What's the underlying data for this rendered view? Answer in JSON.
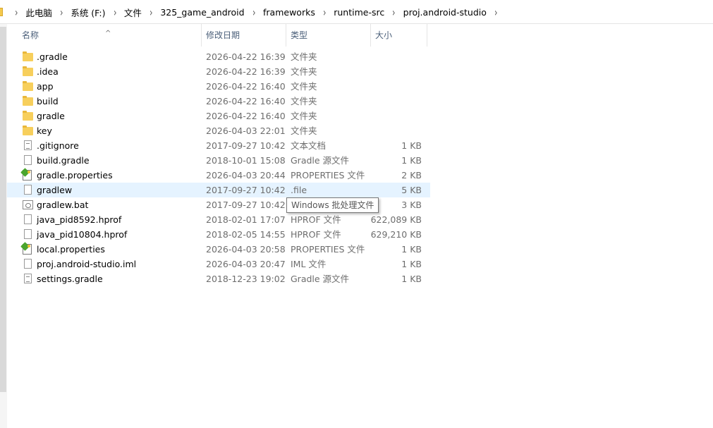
{
  "breadcrumb": [
    "此电脑",
    "系统 (F:)",
    "文件",
    "325_game_android",
    "frameworks",
    "runtime-src",
    "proj.android-studio"
  ],
  "columns": {
    "name": "名称",
    "date": "修改日期",
    "type": "类型",
    "size": "大小"
  },
  "files": [
    {
      "name": ".gradle",
      "date": "2026-04-22 16:39",
      "type": "文件夹",
      "size": "",
      "icon": "folder-icon"
    },
    {
      "name": ".idea",
      "date": "2026-04-22 16:39",
      "type": "文件夹",
      "size": "",
      "icon": "folder-icon"
    },
    {
      "name": "app",
      "date": "2026-04-22 16:40",
      "type": "文件夹",
      "size": "",
      "icon": "folder-icon"
    },
    {
      "name": "build",
      "date": "2026-04-22 16:40",
      "type": "文件夹",
      "size": "",
      "icon": "folder-icon"
    },
    {
      "name": "gradle",
      "date": "2026-04-22 16:40",
      "type": "文件夹",
      "size": "",
      "icon": "folder-icon"
    },
    {
      "name": "key",
      "date": "2026-04-03 22:01",
      "type": "文件夹",
      "size": "",
      "icon": "folder-icon"
    },
    {
      "name": ".gitignore",
      "date": "2017-09-27 10:42",
      "type": "文本文档",
      "size": "1 KB",
      "icon": "text-document-icon"
    },
    {
      "name": "build.gradle",
      "date": "2018-10-01 15:08",
      "type": "Gradle 源文件",
      "size": "1 KB",
      "icon": "blank-file-icon"
    },
    {
      "name": "gradle.properties",
      "date": "2026-04-03 20:44",
      "type": "PROPERTIES 文件",
      "size": "2 KB",
      "icon": "properties-file-icon"
    },
    {
      "name": "gradlew",
      "date": "2017-09-27 10:42",
      "type": ".file",
      "size": "5 KB",
      "icon": "blank-file-icon"
    },
    {
      "name": "gradlew.bat",
      "date": "2017-09-27 10:42",
      "type": "",
      "size": "3 KB",
      "icon": "batch-file-icon"
    },
    {
      "name": "java_pid8592.hprof",
      "date": "2018-02-01 17:07",
      "type": "HPROF 文件",
      "size": "622,089 KB",
      "icon": "blank-file-icon"
    },
    {
      "name": "java_pid10804.hprof",
      "date": "2018-02-05 14:55",
      "type": "HPROF 文件",
      "size": "629,210 KB",
      "icon": "blank-file-icon"
    },
    {
      "name": "local.properties",
      "date": "2026-04-03 20:58",
      "type": "PROPERTIES 文件",
      "size": "1 KB",
      "icon": "properties-file-icon"
    },
    {
      "name": "proj.android-studio.iml",
      "date": "2026-04-03 20:47",
      "type": "IML 文件",
      "size": "1 KB",
      "icon": "blank-file-icon"
    },
    {
      "name": "settings.gradle",
      "date": "2018-12-23 19:02",
      "type": "Gradle 源文件",
      "size": "1 KB",
      "icon": "text-document-icon"
    }
  ],
  "tooltip": "Windows 批处理文件",
  "colors": {
    "hover_row": "#e5f3ff",
    "header_text": "#4c607a",
    "folder": "#f7cf5c"
  }
}
